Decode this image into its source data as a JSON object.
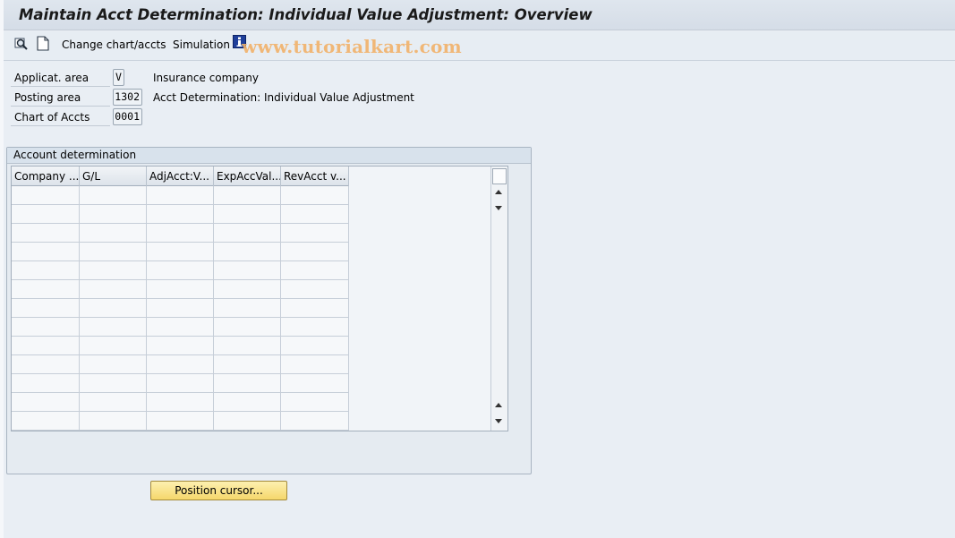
{
  "window": {
    "title": "Maintain Acct Determination: Individual Value Adjustment: Overview"
  },
  "toolbar": {
    "change_chart_label": "Change chart/accts",
    "simulation_label": "Simulation",
    "watermark": "www.tutorialkart.com"
  },
  "header_fields": {
    "applicat_area": {
      "label": "Applicat. area",
      "value": "V",
      "description": "Insurance company"
    },
    "posting_area": {
      "label": "Posting area",
      "value": "1302",
      "description": "Acct Determination: Individual Value Adjustment"
    },
    "chart_of_accts": {
      "label": "Chart of Accts",
      "value": "0001"
    }
  },
  "account_determination": {
    "group_title": "Account determination",
    "columns": [
      "Company ...",
      "G/L",
      "AdjAcct:V...",
      "ExpAccVal...",
      "RevAcct v..."
    ],
    "row_count": 13
  },
  "buttons": {
    "position_cursor": "Position cursor..."
  },
  "colors": {
    "background": "#e9eef4",
    "button_fill": "#f5d76b",
    "watermark": "#f2b26a",
    "info_icon": "#1f3f9a"
  }
}
